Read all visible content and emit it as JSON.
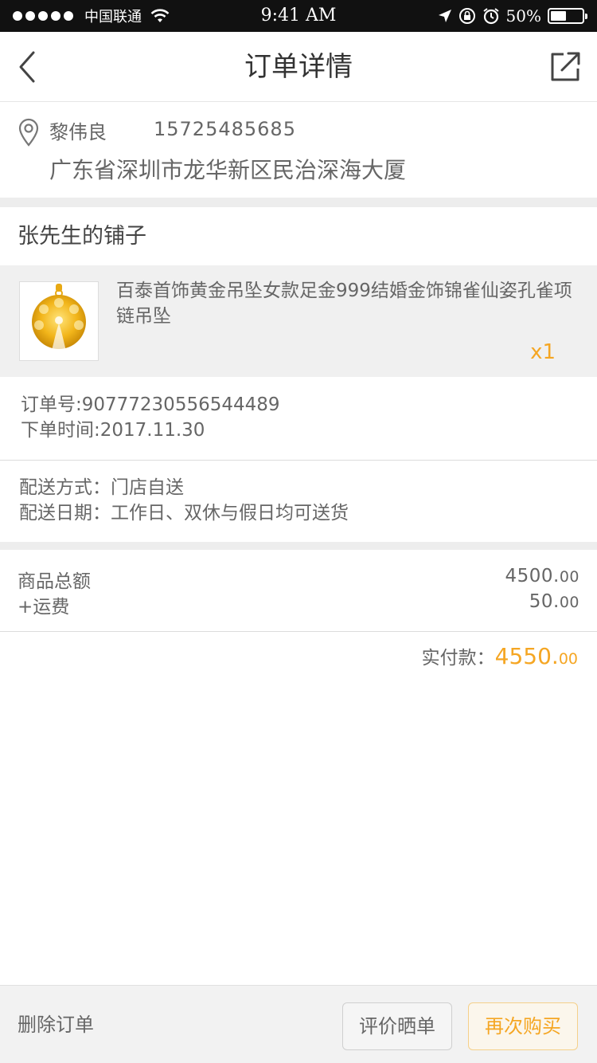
{
  "status_bar": {
    "carrier": "中国联通",
    "time": "9:41 AM",
    "battery": "50%",
    "battery_level": 0.5
  },
  "nav": {
    "title": "订单详情"
  },
  "address": {
    "name": "黎伟良",
    "phone": "15725485685",
    "detail": "广东省深圳市龙华新区民治深海大厦"
  },
  "shop": {
    "name": "张先生的铺子"
  },
  "product": {
    "title": "百泰首饰黄金吊坠女款足金999结婚金饰锦雀仙姿孔雀项链吊坠",
    "quantity": "x1"
  },
  "order": {
    "number": "订单号:907772305565444​89",
    "time": "下单时间:2017.11.30"
  },
  "delivery": {
    "method": "配送方式：门店自送",
    "date": "配送日期：工作日、双休与假日均可送货"
  },
  "amounts": {
    "goods_label": "商品总额",
    "goods_int": "4500.",
    "goods_dec": "00",
    "shipping_label": "+运费",
    "shipping_int": "50.",
    "shipping_dec": "00",
    "paid_label": "实付款：",
    "paid_int": "4550.",
    "paid_dec": "00"
  },
  "actions": {
    "delete": "删除订单",
    "review": "评价晒单",
    "rebuy": "再次购买"
  },
  "colors": {
    "accent": "#f5a623",
    "status_bar": "#111111"
  }
}
